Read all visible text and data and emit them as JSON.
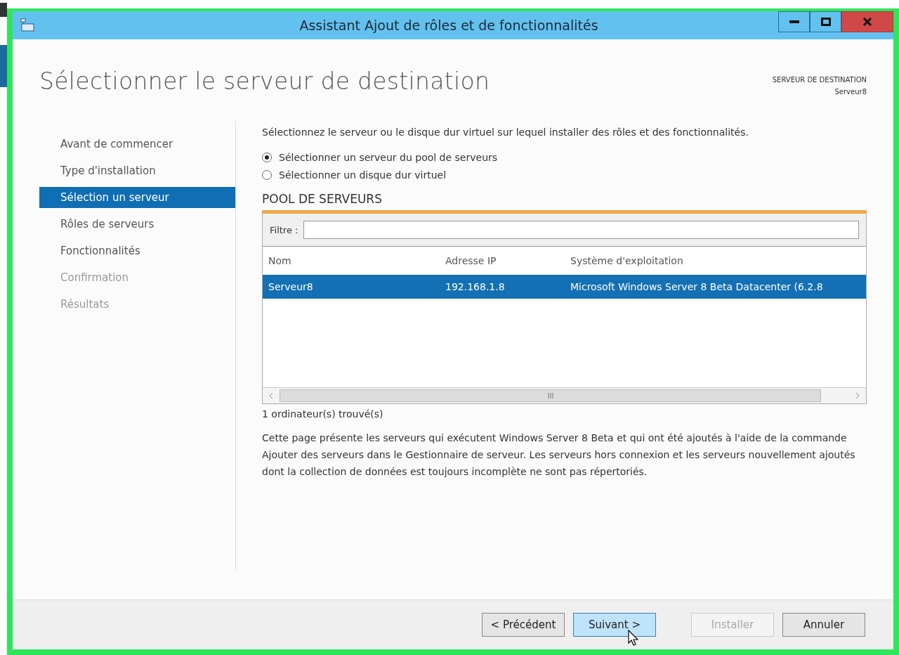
{
  "window": {
    "title": "Assistant Ajout de rôles et de fonctionnalités"
  },
  "page_title": "Sélectionner le serveur de destination",
  "destination": {
    "label": "SERVEUR DE DESTINATION",
    "server": "Serveur8"
  },
  "steps": [
    {
      "label": "Avant de commencer",
      "selected": false,
      "disabled": false
    },
    {
      "label": "Type d'installation",
      "selected": false,
      "disabled": false
    },
    {
      "label": "Sélection un serveur",
      "selected": true,
      "disabled": false
    },
    {
      "label": "Rôles de serveurs",
      "selected": false,
      "disabled": false
    },
    {
      "label": "Fonctionnalités",
      "selected": false,
      "disabled": false
    },
    {
      "label": "Confirmation",
      "selected": false,
      "disabled": true
    },
    {
      "label": "Résultats",
      "selected": false,
      "disabled": true
    }
  ],
  "intro": "Sélectionnez le serveur ou le disque dur virtuel sur lequel installer des rôles et des fonctionnalités.",
  "options": [
    {
      "label": "Sélectionner un serveur du pool de serveurs",
      "selected": true
    },
    {
      "label": "Sélectionner un disque dur virtuel",
      "selected": false
    }
  ],
  "pool": {
    "heading": "POOL DE SERVEURS",
    "filter_label": "Filtre :",
    "columns": [
      "Nom",
      "Adresse IP",
      "Système d'exploitation"
    ],
    "rows": [
      {
        "cells": [
          "Serveur8",
          "192.168.1.8",
          "Microsoft Windows Server 8 Beta Datacenter (6.2.8"
        ],
        "selected": true
      }
    ],
    "count": "1 ordinateur(s) trouvé(s)"
  },
  "note": "Cette page présente les serveurs qui exécutent Windows Server 8 Beta et qui ont été ajoutés à l'aide de la commande Ajouter des serveurs dans le Gestionnaire de serveur. Les serveurs hors connexion et les serveurs nouvellement ajoutés dont la collection de données est toujours incomplète ne sont pas répertoriés.",
  "buttons": [
    {
      "label": "< Précédent",
      "disabled": false,
      "focused": false
    },
    {
      "label": "Suivant >",
      "disabled": false,
      "focused": true
    },
    {
      "label": "Installer",
      "disabled": true,
      "focused": false
    },
    {
      "label": "Annuler",
      "disabled": false,
      "focused": false
    }
  ]
}
